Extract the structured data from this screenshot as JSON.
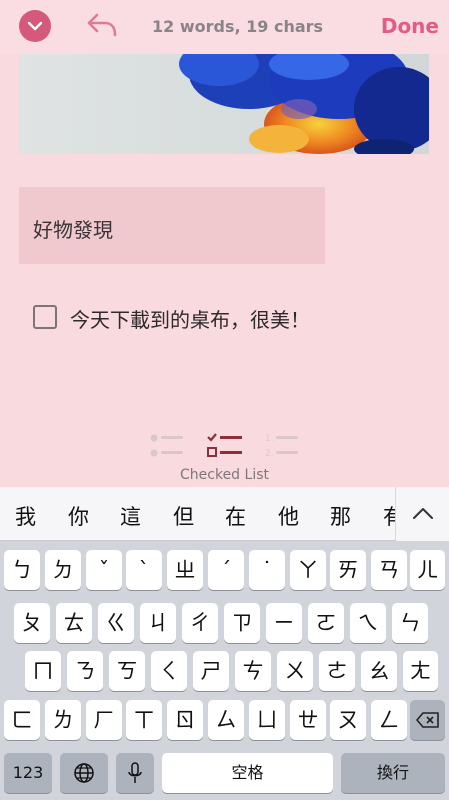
{
  "toolbar": {
    "menu_icon": "chevron-down-icon",
    "undo_icon": "undo-icon",
    "word_count": "12 words, 19 chars",
    "done_label": "Done",
    "accent_color": "#e15d84"
  },
  "note": {
    "heading": "好物發現",
    "checklist": [
      {
        "text": "今天下載到的桌布，很美！",
        "checked": false
      }
    ]
  },
  "format_bar": {
    "options": [
      "bullet-list-icon",
      "checked-list-icon",
      "numbered-list-icon"
    ],
    "selected_label": "Checked List"
  },
  "keyboard": {
    "candidates": [
      "我",
      "你",
      "這",
      "但",
      "在",
      "他",
      "那",
      "有"
    ],
    "rows": [
      [
        "ㄅ",
        "ㄉ",
        "ˇ",
        "ˋ",
        "ㄓ",
        "ˊ",
        "˙",
        "ㄚ",
        "ㄞ",
        "ㄢ",
        "ㄦ"
      ],
      [
        "ㄆ",
        "ㄊ",
        "ㄍ",
        "ㄐ",
        "ㄔ",
        "ㄗ",
        "ㄧ",
        "ㄛ",
        "ㄟ",
        "ㄣ"
      ],
      [
        "ㄇ",
        "ㄋ",
        "ㄎ",
        "ㄑ",
        "ㄕ",
        "ㄘ",
        "ㄨ",
        "ㄜ",
        "ㄠ",
        "ㄤ"
      ],
      [
        "ㄈ",
        "ㄌ",
        "ㄏ",
        "ㄒ",
        "ㄖ",
        "ㄙ",
        "ㄩ",
        "ㄝ",
        "ㄡ",
        "ㄥ"
      ]
    ],
    "numbers_label": "123",
    "space_label": "空格",
    "return_label": "換行"
  }
}
